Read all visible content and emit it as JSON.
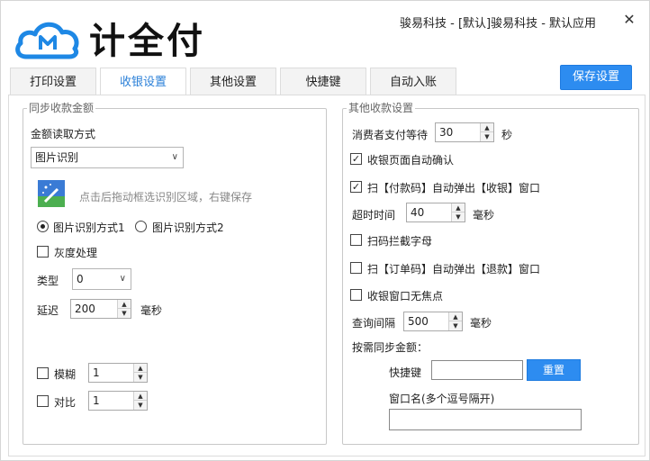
{
  "header": {
    "brand": "计全付",
    "title": "骏易科技 - [默认]骏易科技 - 默认应用",
    "close": "✕"
  },
  "tabs": [
    {
      "label": "打印设置",
      "active": false
    },
    {
      "label": "收银设置",
      "active": true
    },
    {
      "label": "其他设置",
      "active": false
    },
    {
      "label": "快捷键",
      "active": false
    },
    {
      "label": "自动入账",
      "active": false
    }
  ],
  "save_label": "保存设置",
  "left": {
    "legend": "同步收款金额",
    "read_method_label": "金额读取方式",
    "read_method_value": "图片识别",
    "hint": "点击后拖动框选识别区域，右键保存",
    "radio1": "图片识别方式1",
    "radio2": "图片识别方式2",
    "gray_label": "灰度处理",
    "type_label": "类型",
    "type_value": "0",
    "delay_label": "延迟",
    "delay_value": "200",
    "delay_unit": "毫秒",
    "blur_label": "模糊",
    "blur_value": "1",
    "contrast_label": "对比",
    "contrast_value": "1"
  },
  "right": {
    "legend": "其他收款设置",
    "wait_label": "消费者支付等待",
    "wait_value": "30",
    "wait_unit": "秒",
    "auto_confirm": "收银页面自动确认",
    "scan_pay": "扫【付款码】自动弹出【收银】窗口",
    "timeout_label": "超时时间",
    "timeout_value": "40",
    "timeout_unit": "毫秒",
    "intercept": "扫码拦截字母",
    "scan_order": "扫【订单码】自动弹出【退款】窗口",
    "no_focus": "收银窗口无焦点",
    "query_label": "查询间隔",
    "query_value": "500",
    "query_unit": "毫秒",
    "sync_label": "按需同步金额：",
    "hotkey_label": "快捷键",
    "reset_label": "重置",
    "window_name_label": "窗口名(多个逗号隔开)"
  },
  "check": {
    "mark": "✓",
    "up": "▲",
    "down": "▼",
    "chev": "∨"
  },
  "colors": {
    "accent": "#2d8cf0",
    "active_tab_text": "#2b80d8"
  }
}
